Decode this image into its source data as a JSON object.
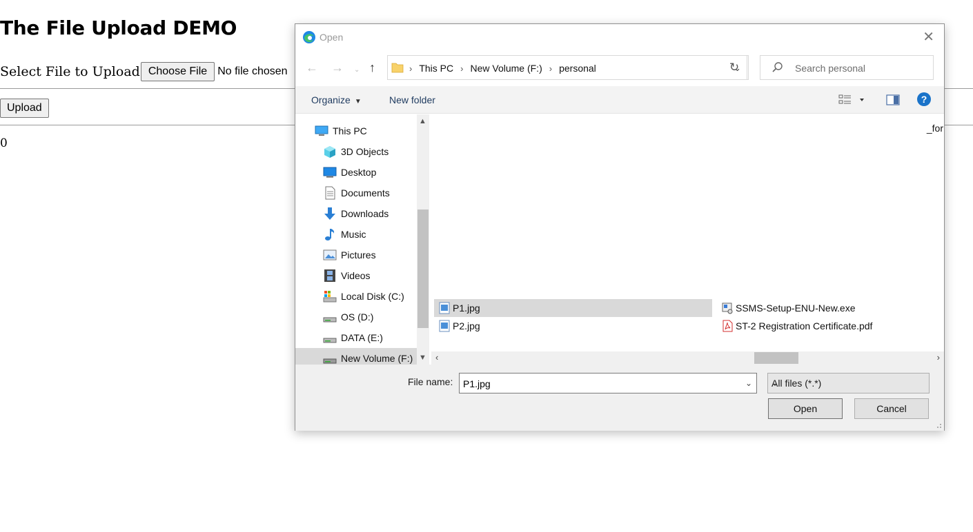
{
  "page": {
    "title": "The File Upload DEMO",
    "select_label": "Select File to Upload",
    "choose_button": "Choose File",
    "no_file_text": "No file chosen",
    "upload_button": "Upload",
    "count": "0"
  },
  "dialog": {
    "title": "Open",
    "breadcrumbs": [
      "This PC",
      "New Volume (F:)",
      "personal"
    ],
    "search_placeholder": "Search personal",
    "toolbar": {
      "organize": "Organize",
      "new_folder": "New folder",
      "help": "?"
    },
    "nav_items": [
      {
        "label": "This PC",
        "icon": "computer-icon"
      },
      {
        "label": "3D Objects",
        "icon": "cube-icon"
      },
      {
        "label": "Desktop",
        "icon": "desktop-icon"
      },
      {
        "label": "Documents",
        "icon": "document-icon"
      },
      {
        "label": "Downloads",
        "icon": "download-icon"
      },
      {
        "label": "Music",
        "icon": "music-icon"
      },
      {
        "label": "Pictures",
        "icon": "pictures-icon"
      },
      {
        "label": "Videos",
        "icon": "videos-icon"
      },
      {
        "label": "Local Disk (C:)",
        "icon": "drive-icon"
      },
      {
        "label": "OS (D:)",
        "icon": "drive-icon"
      },
      {
        "label": "DATA (E:)",
        "icon": "drive-icon"
      },
      {
        "label": "New Volume (F:)",
        "icon": "drive-icon"
      }
    ],
    "partial_top_text": "_for",
    "files": [
      {
        "name": "P1.jpg",
        "icon": "image-file-icon",
        "selected": true
      },
      {
        "name": "P2.jpg",
        "icon": "image-file-icon"
      },
      {
        "name": "SSMS-Setup-ENU-New.exe",
        "icon": "installer-icon"
      },
      {
        "name": "ST-2 Registration Certificate.pdf",
        "icon": "pdf-icon"
      }
    ],
    "file_name_label": "File name:",
    "file_name_value": "P1.jpg",
    "file_type": "All files (*.*)",
    "open_button": "Open",
    "cancel_button": "Cancel"
  },
  "colors": {
    "selection": "#d9d9d9",
    "toolbar_bg": "#f3f3f3",
    "help_blue": "#1a73c9",
    "footer_bg": "#f0f0f0"
  }
}
